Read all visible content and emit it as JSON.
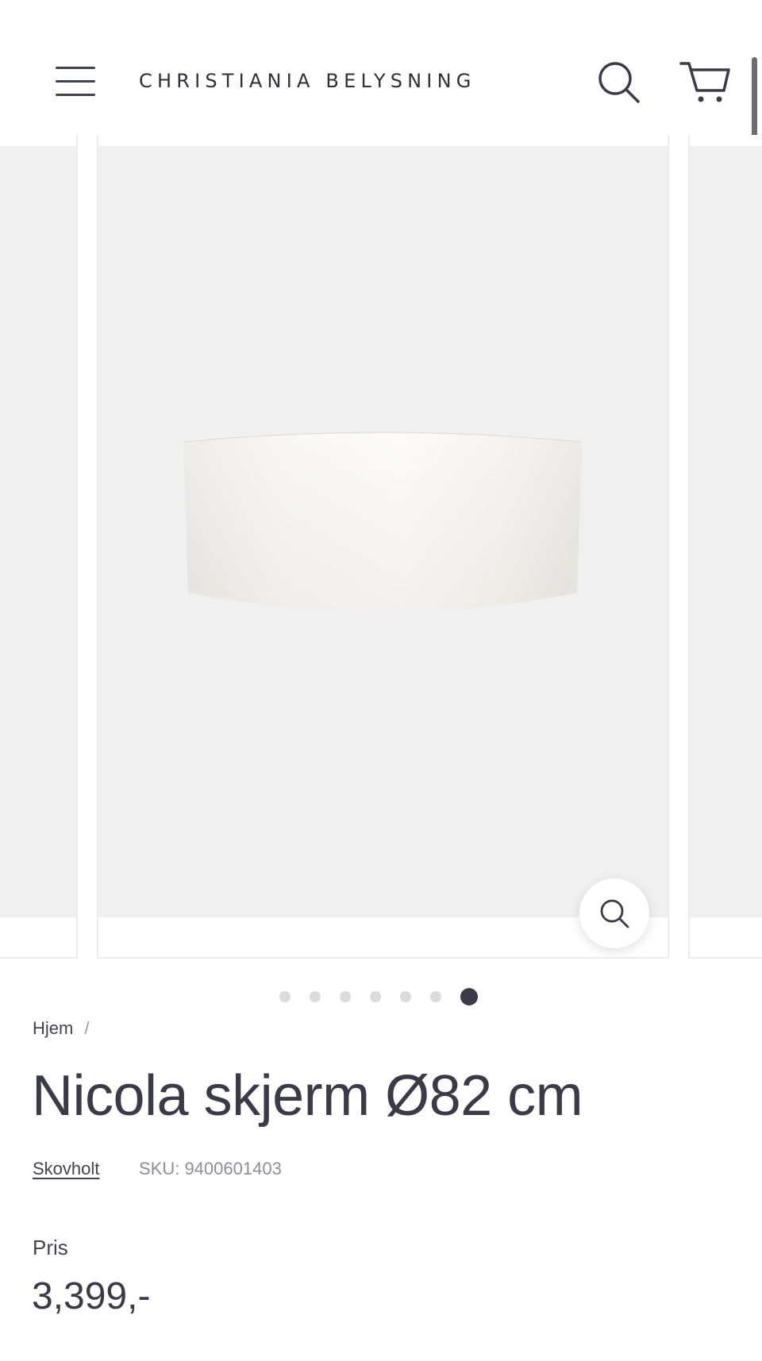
{
  "header": {
    "logo": "CHRISTIANIA BELYSNING"
  },
  "gallery": {
    "slide_count": 7,
    "active_slide": 7
  },
  "breadcrumb": {
    "home": "Hjem",
    "separator": "/"
  },
  "product": {
    "title": "Nicola skjerm Ø82 cm",
    "brand": "Skovholt",
    "sku": "SKU: 9400601403",
    "price_label": "Pris",
    "price": "3,399,-"
  },
  "colors": {
    "text_primary": "#3b3b48",
    "text_secondary": "#8e8e96",
    "image_background": "#f0f0f0",
    "dot_active": "#3c3c48",
    "dot_inactive": "#dcdcdf"
  },
  "icons": [
    "menu-icon",
    "search-icon",
    "cart-icon",
    "zoom-icon"
  ]
}
